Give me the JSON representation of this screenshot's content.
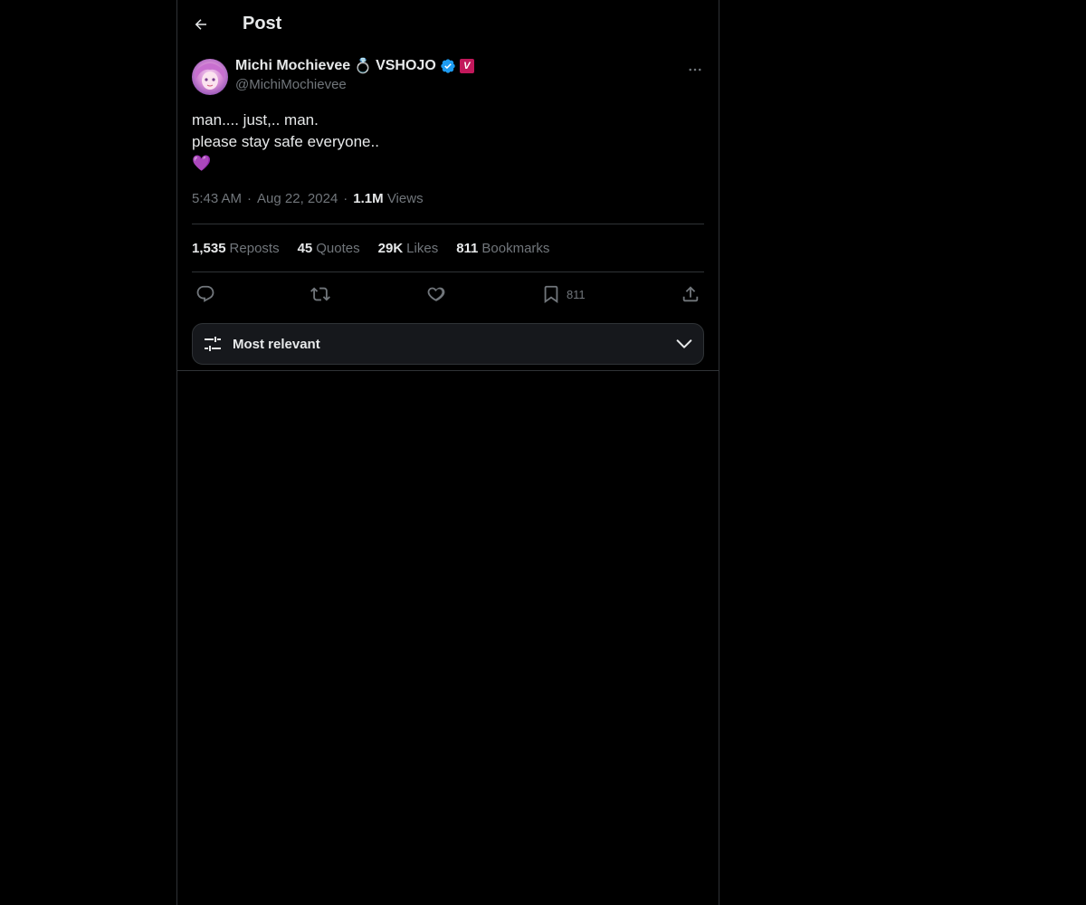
{
  "header": {
    "title": "Post"
  },
  "post": {
    "author": {
      "display_name": "Michi Mochievee",
      "name_emoji": "💍",
      "org": "VSHOJO",
      "affiliate_badge": "V",
      "handle": "@MichiMochievee"
    },
    "text_lines": [
      "man.... just,.. man.",
      "please stay safe everyone..",
      "💜"
    ],
    "meta": {
      "time": "5:43 AM",
      "date": "Aug 22, 2024",
      "views_count": "1.1M",
      "views_label": "Views",
      "separator": "·"
    },
    "stats": {
      "reposts_count": "1,535",
      "reposts_label": "Reposts",
      "quotes_count": "45",
      "quotes_label": "Quotes",
      "likes_count": "29K",
      "likes_label": "Likes",
      "bookmarks_count": "811",
      "bookmarks_label": "Bookmarks"
    },
    "actions": {
      "bookmark_count": "811"
    }
  },
  "replies": {
    "sort_label": "Most relevant"
  },
  "colors": {
    "background": "#000000",
    "text_primary": "#e7e9ea",
    "text_secondary": "#71767b",
    "border": "#2f3336",
    "verified": "#1d9bf0",
    "affiliate_badge": "#c2185b"
  },
  "icons": {
    "back": "arrow-left-icon",
    "more": "more-horizontal-icon",
    "verified": "verified-badge-icon",
    "reply": "reply-icon",
    "repost": "repost-icon",
    "like": "heart-icon",
    "bookmark": "bookmark-icon",
    "share": "share-icon",
    "sort": "sliders-icon",
    "chevron": "chevron-down-icon"
  }
}
